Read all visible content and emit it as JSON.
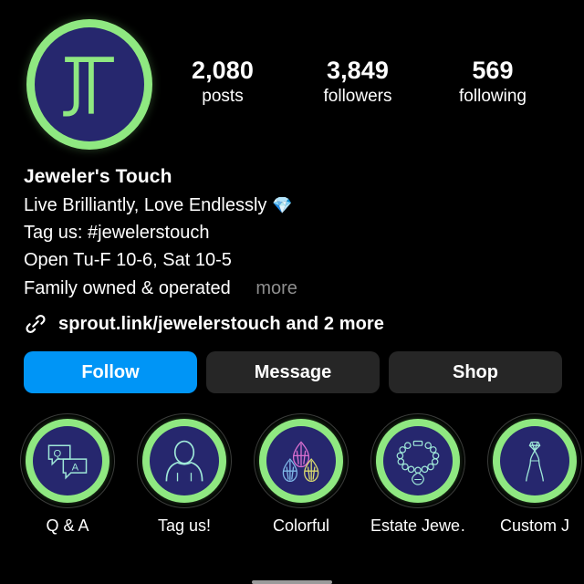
{
  "profile": {
    "avatar_icon": "jt-monogram-logo",
    "display_name": "Jeweler's Touch",
    "bio_lines": [
      "Live Brilliantly, Love Endlessly",
      "Tag us: #jewelerstouch",
      "Open Tu-F 10-6, Sat 10-5",
      "Family owned & operated"
    ],
    "bio_emoji": "💎",
    "more_label": "more",
    "link_icon": "link-chain-icon",
    "link_text": "sprout.link/jewelerstouch and 2 more"
  },
  "stats": [
    {
      "value": "2,080",
      "label": "posts"
    },
    {
      "value": "3,849",
      "label": "followers"
    },
    {
      "value": "569",
      "label": "following"
    }
  ],
  "actions": [
    {
      "label": "Follow",
      "style": "primary"
    },
    {
      "label": "Message",
      "style": "secondary"
    },
    {
      "label": "Shop",
      "style": "secondary"
    }
  ],
  "highlights": [
    {
      "label": "Q & A",
      "icon": "speech-bubbles-qa-icon"
    },
    {
      "label": "Tag us!",
      "icon": "person-silhouette-icon"
    },
    {
      "label": "Colorful",
      "icon": "three-gemstones-icon"
    },
    {
      "label": "Estate Jewe…",
      "icon": "necklace-icon"
    },
    {
      "label": "Custom J",
      "icon": "jewelry-pliers-icon"
    }
  ],
  "colors": {
    "background": "#000000",
    "accent_green": "#8fe881",
    "logo_navy": "#26276e",
    "follow_blue": "#0095f6",
    "secondary_button": "#262626",
    "muted_text": "#8e8e8e",
    "gem_pink": "#d96fd0",
    "gem_blue": "#7fb8e8",
    "gem_yellow": "#d9d96f"
  }
}
